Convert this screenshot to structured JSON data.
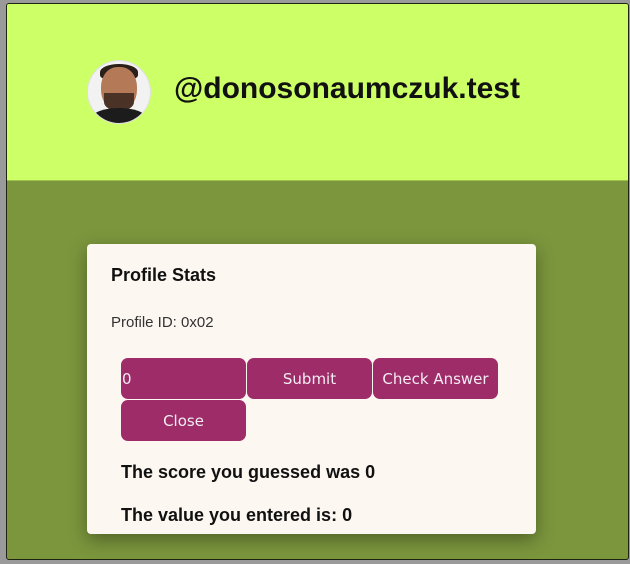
{
  "profile": {
    "username": "@donosonaumczuk.test",
    "avatar_icon": "avatar-photo"
  },
  "modal": {
    "title": "Profile Stats",
    "profile_id": "Profile ID: 0x02",
    "input_value": "0",
    "submit_label": "Submit",
    "check_label": "Check Answer",
    "close_label": "Close",
    "guess_text": "The score you guessed was 0",
    "entered_text": "The value you entered is: 0"
  },
  "colors": {
    "header_bg": "#cdff66",
    "page_bg": "#7b963d",
    "button_bg": "#9e2c69",
    "modal_bg": "#fdf7f1"
  }
}
